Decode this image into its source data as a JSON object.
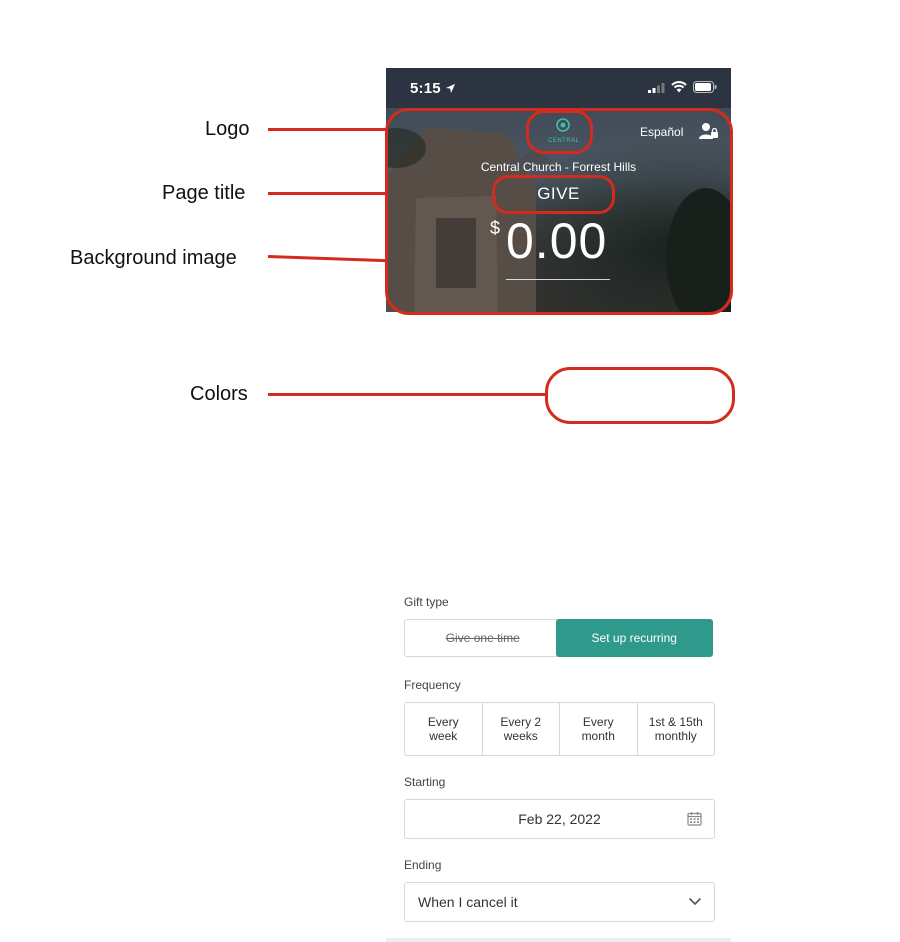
{
  "annotations": {
    "logo": "Logo",
    "page_title": "Page title",
    "background_image": "Background image",
    "colors": "Colors"
  },
  "status_bar": {
    "time": "5:15"
  },
  "header": {
    "logo_text": "CENTRAL",
    "language_link": "Español",
    "church_name": "Central Church - Forrest Hills",
    "page_title": "GIVE",
    "currency_symbol": "$",
    "amount": "0.00"
  },
  "form": {
    "gift_type": {
      "label": "Gift type",
      "options": [
        "Give one time",
        "Set up recurring"
      ],
      "selected": "Set up recurring"
    },
    "frequency": {
      "label": "Frequency",
      "options": [
        {
          "line1": "Every",
          "line2": "week"
        },
        {
          "line1": "Every 2",
          "line2": "weeks"
        },
        {
          "line1": "Every",
          "line2": "month"
        },
        {
          "line1": "1st & 15th",
          "line2": "monthly"
        }
      ]
    },
    "starting": {
      "label": "Starting",
      "value": "Feb 22, 2022"
    },
    "ending": {
      "label": "Ending",
      "value": "When I cancel it"
    }
  },
  "colors": {
    "accent": "#2f9a8c",
    "callout": "#d42b1e",
    "status_bar": "#2b3440"
  }
}
